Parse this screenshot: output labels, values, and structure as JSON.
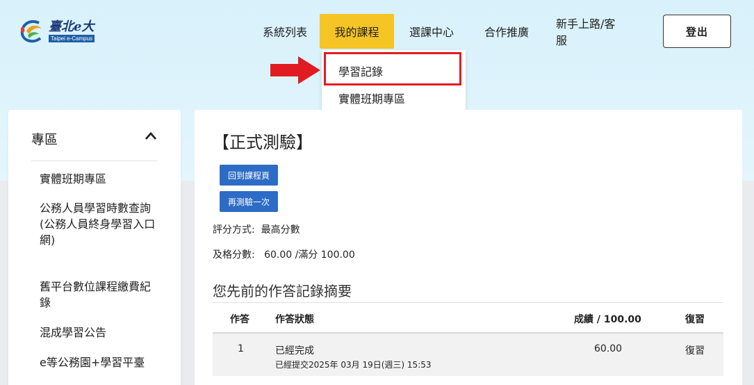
{
  "logo": {
    "cn_text": "臺北e大",
    "en_text": "Taipei e-Campus",
    "icon": "taipei-ecampus-logo"
  },
  "nav": {
    "items": [
      {
        "label": "系統列表"
      },
      {
        "label": "我的課程"
      },
      {
        "label": "選課中心"
      },
      {
        "label": "合作推廣"
      },
      {
        "label": "新手上路/客服"
      }
    ],
    "active_index": 1,
    "login_label": "登出"
  },
  "dropdown": {
    "items": [
      {
        "label": "學習記錄"
      },
      {
        "label": "實體班期專區"
      }
    ]
  },
  "sidebar": {
    "title": "專區",
    "items": [
      {
        "label": "實體班期專區"
      },
      {
        "label": "公務人員學習時數查詢\n(公務人員終身學習入口網)"
      },
      {
        "label": "舊平台數位課程繳費紀錄"
      },
      {
        "label": "混成學習公告"
      },
      {
        "label": "e等公務園+學習平臺"
      }
    ]
  },
  "main": {
    "title": "【正式測驗】",
    "back_button": "回到課程頁",
    "retry_button": "再測驗一次",
    "grading_method": "評分方式:  最高分數",
    "passing_score": "及格分數:   60.00 /滿分 100.00",
    "summary_title": "您先前的作答記錄摘要",
    "table": {
      "headers": [
        "作答",
        "作答狀態",
        "成績 / 100.00",
        "復習"
      ],
      "rows": [
        {
          "attempt": "1",
          "status": "已經完成",
          "submitted": "已經提交2025年 03月 19日(週三) 15:53",
          "score": "60.00",
          "review": "復習"
        }
      ]
    }
  },
  "colors": {
    "accent_yellow": "#f5c425",
    "button_blue": "#2d6cc6",
    "highlight_red": "#e11b22"
  }
}
